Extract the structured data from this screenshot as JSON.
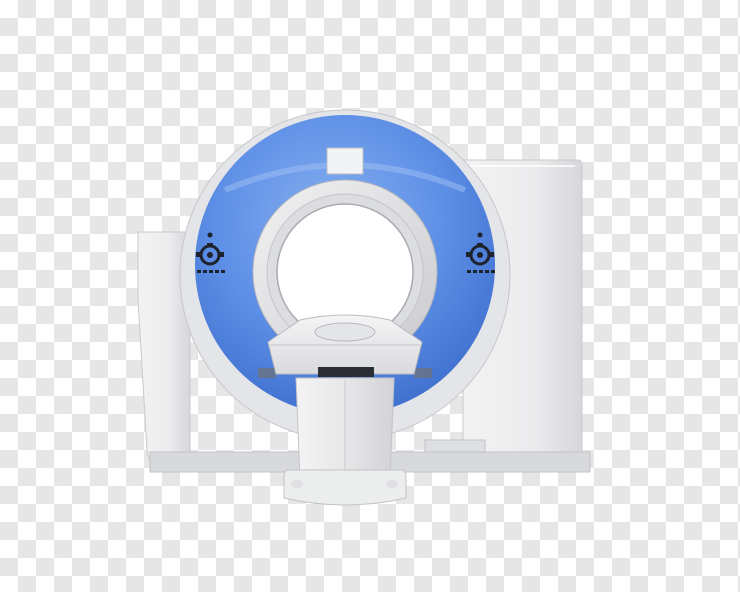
{
  "image": {
    "subject": "ct-scanner",
    "background": "transparency-checkerboard",
    "colors": {
      "checker_light": "#ffffff",
      "checker_dark": "#e6e6e6",
      "gantry_blue": "#5b8ee6",
      "gantry_blue_dark": "#3f6fcc",
      "housing_gray": "#e8e8ea",
      "housing_shadow": "#c9cacd",
      "control_black": "#1f232b"
    }
  }
}
